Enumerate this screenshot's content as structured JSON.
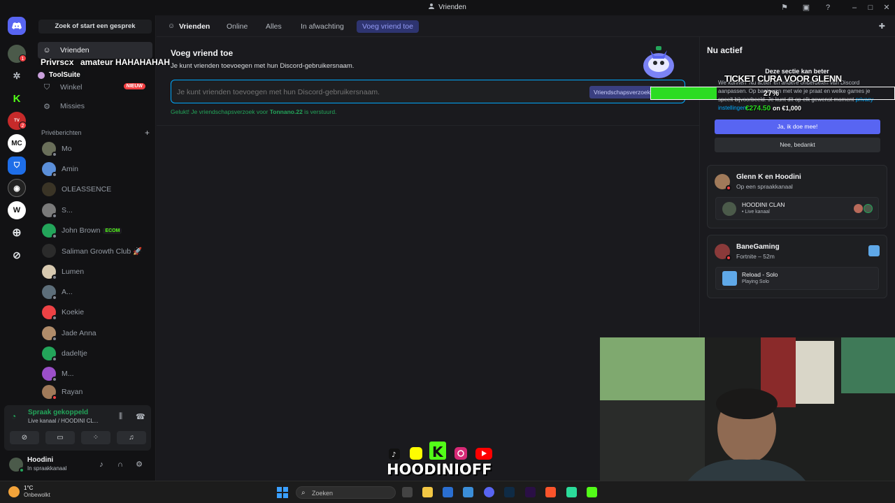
{
  "window": {
    "title": "Vrienden"
  },
  "sidebar": {
    "search_label": "Zoek of start een gesprek",
    "nav": [
      {
        "label": "Vrienden"
      },
      {
        "label": "Winkel",
        "badge": "NIEUW"
      },
      {
        "label": "Missies"
      }
    ],
    "dm_header": "Privéberichten",
    "dms": [
      {
        "name": "Mo"
      },
      {
        "name": "Amin"
      },
      {
        "name": "OLEASSENCE"
      },
      {
        "name": "S..."
      },
      {
        "name": "John Brown",
        "tag": "ECOM"
      },
      {
        "name": "Saliman Growth Club 🚀"
      },
      {
        "name": "Lumen"
      },
      {
        "name": "A..."
      },
      {
        "name": "Koekie"
      },
      {
        "name": "Jade Anna"
      },
      {
        "name": "dadeltje"
      },
      {
        "name": "M..."
      },
      {
        "name": "Rayan"
      }
    ],
    "tooltip": "ToolSuite",
    "overlay_name": "Privrscx",
    "overlay_msg": "amateur HAHAHAHAH"
  },
  "voice": {
    "title": "Spraak gekoppeld",
    "subtitle": "Live kanaal / HOODINI CL..."
  },
  "user": {
    "name": "Hoodini",
    "status": "In spraakkanaal"
  },
  "tabs": [
    {
      "label": "Vrienden"
    },
    {
      "label": "Online"
    },
    {
      "label": "Alles"
    },
    {
      "label": "In afwachting"
    },
    {
      "label": "Voeg vriend toe"
    }
  ],
  "add_friend": {
    "title": "Voeg vriend toe",
    "description": "Je kunt vrienden toevoegen met hun Discord-gebruikersnaam.",
    "placeholder": "Je kunt vrienden toevoegen met hun Discord-gebruikersnaam.",
    "send_label": "Vriendschapsverzoek",
    "success_prefix": "Gelukt! Je vriendschapsverzoek voor ",
    "success_user": "Tonnano.22",
    "success_suffix": " is verstuurd."
  },
  "active_now": {
    "title": "Nu actief",
    "prompt_title": "Deze sectie kan beter",
    "prompt_body": "We kunnen 'Nu actief' en andere onderdelen van Discord aanpassen. Op basis van met wie je praat en welke games je speelt bijvoorbeeld. Je kunt dit op elk gewenst moment",
    "prompt_link": "privacy-instellingen.",
    "yes_label": "Ja, ik doe mee!",
    "no_label": "Nee, bedankt",
    "cards": [
      {
        "name": "Glenn K en Hoodini",
        "sub": "Op een spraakkanaal",
        "inner_title": "HOODINI CLAN",
        "inner_sub": "• Live kanaal"
      },
      {
        "name": "BaneGaming",
        "sub": "Fortnite – 52m",
        "inner_title": "Reload - Solo",
        "inner_sub": "Playing Solo"
      }
    ]
  },
  "stream_overlay": {
    "ticket_text": "TICKET CURA VOOR GLENN",
    "progress_percent": 27,
    "progress_label": "27%",
    "amount_current": "€274.50",
    "amount_of": "on €1,000",
    "brand": "HOODINIOFF"
  },
  "taskbar": {
    "weather_temp": "1°C",
    "weather_desc": "Onbewolkt",
    "search_label": "Zoeken"
  },
  "colors": {
    "accent": "#5865f2",
    "online": "#23a55a",
    "danger": "#f23f42",
    "progress": "#2bdc22"
  }
}
